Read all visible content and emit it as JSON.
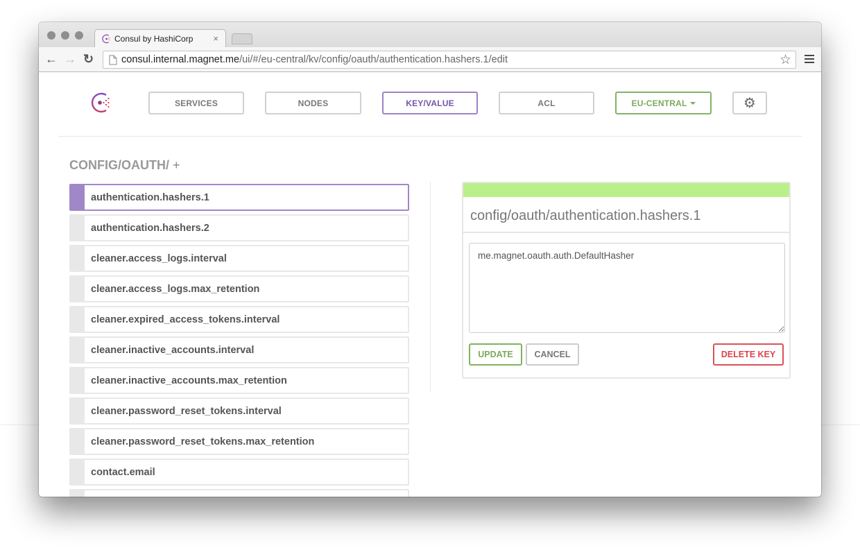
{
  "browser": {
    "tab_title": "Consul by HashiCorp",
    "tab_close": "×",
    "url_host": "consul.internal.magnet.me",
    "url_path": "/ui/#/eu-central/kv/config/oauth/authentication.hashers.1/edit",
    "back_glyph": "←",
    "forward_glyph": "→",
    "reload_glyph": "↻",
    "star_glyph": "☆",
    "page_glyph": "🗋"
  },
  "nav": {
    "items": [
      {
        "label": "SERVICES"
      },
      {
        "label": "NODES"
      },
      {
        "label": "KEY/VALUE"
      },
      {
        "label": "ACL"
      }
    ],
    "datacenter": "EU-CENTRAL",
    "settings_glyph": "⚙",
    "active": "KEY/VALUE"
  },
  "breadcrumb": {
    "path": "CONFIG/OAUTH/",
    "add": "+"
  },
  "keys": [
    {
      "label": "authentication.hashers.1"
    },
    {
      "label": "authentication.hashers.2"
    },
    {
      "label": "cleaner.access_logs.interval"
    },
    {
      "label": "cleaner.access_logs.max_retention"
    },
    {
      "label": "cleaner.expired_access_tokens.interval"
    },
    {
      "label": "cleaner.inactive_accounts.interval"
    },
    {
      "label": "cleaner.inactive_accounts.max_retention"
    },
    {
      "label": "cleaner.password_reset_tokens.interval"
    },
    {
      "label": "cleaner.password_reset_tokens.max_retention"
    },
    {
      "label": "contact.email"
    },
    {
      "label": ""
    }
  ],
  "editor": {
    "title": "config/oauth/authentication.hashers.1",
    "value": "me.magnet.oauth.auth.DefaultHasher",
    "update_label": "UPDATE",
    "cancel_label": "CANCEL",
    "delete_label": "DELETE KEY"
  },
  "colors": {
    "accent_purple": "#a087c8",
    "accent_green": "#7aab5b",
    "status_bar_green": "#baf08a",
    "danger_red": "#d9444d"
  }
}
